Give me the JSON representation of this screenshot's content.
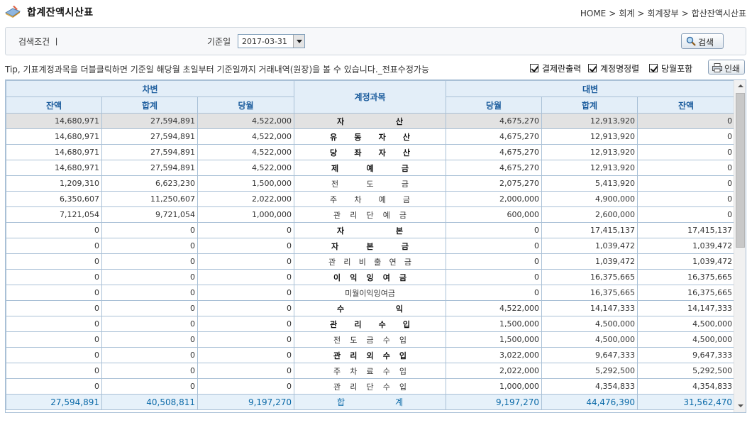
{
  "header": {
    "title": "합계잔액시산표",
    "breadcrumb": [
      "HOME",
      "회계",
      "회계장부",
      "합산잔액시산표"
    ],
    "icon": "book-pencil-icon"
  },
  "search": {
    "condition_label": "검색조건 ㅣ",
    "date_label": "기준일",
    "date_value": "2017-03-31",
    "button_label": "검색"
  },
  "toolbar": {
    "tip": "Tip, 기표계정과목을 더블클릭하면 기준일 해당월 초일부터 기준일까지 거래내역(원장)을 볼 수 있습니다._전표수정가능",
    "options": [
      {
        "label": "결제란출력",
        "checked": true
      },
      {
        "label": "계정명정렬",
        "checked": true
      },
      {
        "label": "당월포함",
        "checked": true
      }
    ],
    "print_label": "인쇄"
  },
  "table": {
    "debit_header": "차변",
    "credit_header": "대변",
    "account_header": "계정과목",
    "debit_columns": [
      "잔액",
      "합계",
      "당월"
    ],
    "credit_columns": [
      "당월",
      "합계",
      "잔액"
    ],
    "rows": [
      {
        "d_bal": "14,680,971",
        "d_sum": "27,594,891",
        "d_cur": "4,522,000",
        "acct": "자산",
        "bold": true,
        "c_cur": "4,675,270",
        "c_sum": "12,913,920",
        "c_bal": "0"
      },
      {
        "d_bal": "14,680,971",
        "d_sum": "27,594,891",
        "d_cur": "4,522,000",
        "acct": "유동자산",
        "bold": true,
        "c_cur": "4,675,270",
        "c_sum": "12,913,920",
        "c_bal": "0"
      },
      {
        "d_bal": "14,680,971",
        "d_sum": "27,594,891",
        "d_cur": "4,522,000",
        "acct": "당좌자산",
        "bold": true,
        "c_cur": "4,675,270",
        "c_sum": "12,913,920",
        "c_bal": "0"
      },
      {
        "d_bal": "14,680,971",
        "d_sum": "27,594,891",
        "d_cur": "4,522,000",
        "acct": "제예금",
        "bold": true,
        "c_cur": "4,675,270",
        "c_sum": "12,913,920",
        "c_bal": "0"
      },
      {
        "d_bal": "1,209,310",
        "d_sum": "6,623,230",
        "d_cur": "1,500,000",
        "acct": "전도금",
        "bold": false,
        "c_cur": "2,075,270",
        "c_sum": "5,413,920",
        "c_bal": "0"
      },
      {
        "d_bal": "6,350,607",
        "d_sum": "11,250,607",
        "d_cur": "2,022,000",
        "acct": "주차예금",
        "bold": false,
        "c_cur": "2,000,000",
        "c_sum": "4,900,000",
        "c_bal": "0"
      },
      {
        "d_bal": "7,121,054",
        "d_sum": "9,721,054",
        "d_cur": "1,000,000",
        "acct": "관리단예금",
        "bold": false,
        "c_cur": "600,000",
        "c_sum": "2,600,000",
        "c_bal": "0"
      },
      {
        "d_bal": "0",
        "d_sum": "0",
        "d_cur": "0",
        "acct": "자본",
        "bold": true,
        "c_cur": "0",
        "c_sum": "17,415,137",
        "c_bal": "17,415,137"
      },
      {
        "d_bal": "0",
        "d_sum": "0",
        "d_cur": "0",
        "acct": "자본금",
        "bold": true,
        "c_cur": "0",
        "c_sum": "1,039,472",
        "c_bal": "1,039,472"
      },
      {
        "d_bal": "0",
        "d_sum": "0",
        "d_cur": "0",
        "acct": "관리비출연금",
        "bold": false,
        "c_cur": "0",
        "c_sum": "1,039,472",
        "c_bal": "1,039,472"
      },
      {
        "d_bal": "0",
        "d_sum": "0",
        "d_cur": "0",
        "acct": "이익잉여금",
        "bold": true,
        "c_cur": "0",
        "c_sum": "16,375,665",
        "c_bal": "16,375,665"
      },
      {
        "d_bal": "0",
        "d_sum": "0",
        "d_cur": "0",
        "acct": "미월이익잉여금",
        "bold": false,
        "plain": true,
        "c_cur": "0",
        "c_sum": "16,375,665",
        "c_bal": "16,375,665"
      },
      {
        "d_bal": "0",
        "d_sum": "0",
        "d_cur": "0",
        "acct": "수익",
        "bold": true,
        "c_cur": "4,522,000",
        "c_sum": "14,147,333",
        "c_bal": "14,147,333"
      },
      {
        "d_bal": "0",
        "d_sum": "0",
        "d_cur": "0",
        "acct": "관리수입",
        "bold": true,
        "c_cur": "1,500,000",
        "c_sum": "4,500,000",
        "c_bal": "4,500,000"
      },
      {
        "d_bal": "0",
        "d_sum": "0",
        "d_cur": "0",
        "acct": "전도금수입",
        "bold": false,
        "c_cur": "1,500,000",
        "c_sum": "4,500,000",
        "c_bal": "4,500,000"
      },
      {
        "d_bal": "0",
        "d_sum": "0",
        "d_cur": "0",
        "acct": "관리외수입",
        "bold": true,
        "c_cur": "3,022,000",
        "c_sum": "9,647,333",
        "c_bal": "9,647,333"
      },
      {
        "d_bal": "0",
        "d_sum": "0",
        "d_cur": "0",
        "acct": "주차료수입",
        "bold": false,
        "c_cur": "2,022,000",
        "c_sum": "5,292,500",
        "c_bal": "5,292,500"
      },
      {
        "d_bal": "0",
        "d_sum": "0",
        "d_cur": "0",
        "acct": "관리단수입",
        "bold": false,
        "c_cur": "1,000,000",
        "c_sum": "4,354,833",
        "c_bal": "4,354,833"
      }
    ],
    "total": {
      "d_bal": "27,594,891",
      "d_sum": "40,508,811",
      "d_cur": "9,197,270",
      "acct": "합계",
      "c_cur": "9,197,270",
      "c_sum": "44,476,390",
      "c_bal": "31,562,470"
    }
  }
}
